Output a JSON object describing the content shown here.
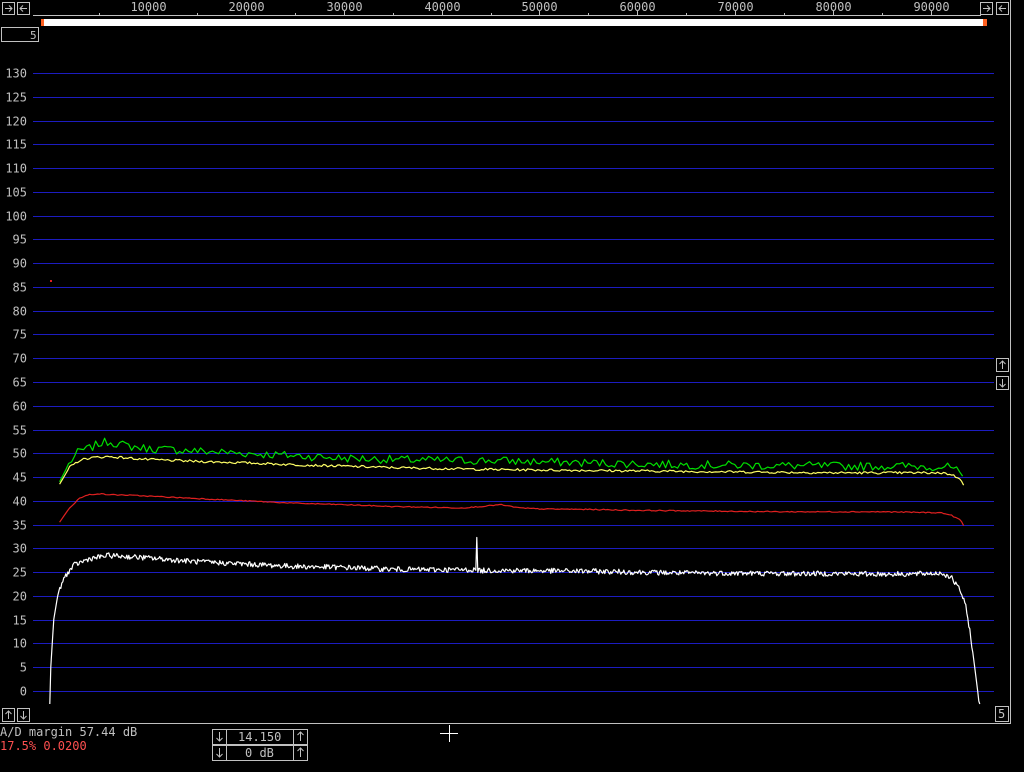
{
  "chart_data": {
    "type": "line",
    "xlabel": "",
    "ylabel": "",
    "xlim": [
      -1000,
      96000
    ],
    "ylim": [
      -5,
      136
    ],
    "x_ticks": [
      10000,
      20000,
      30000,
      40000,
      50000,
      60000,
      70000,
      80000,
      90000
    ],
    "x_tick_labels": [
      "10000",
      "20000",
      "30000",
      "40000",
      "50000",
      "60000",
      "70000",
      "80000",
      "90000"
    ],
    "y_ticks": [
      0,
      5,
      10,
      15,
      20,
      25,
      30,
      35,
      40,
      45,
      50,
      55,
      60,
      65,
      70,
      75,
      80,
      85,
      90,
      95,
      100,
      105,
      110,
      115,
      120,
      125,
      130
    ],
    "y_tick_labels": [
      "0",
      "5",
      "10",
      "15",
      "20",
      "25",
      "30",
      "35",
      "40",
      "45",
      "50",
      "55",
      "60",
      "65",
      "70",
      "75",
      "80",
      "85",
      "90",
      "95",
      "100",
      "105",
      "110",
      "115",
      "120",
      "125",
      "130"
    ],
    "grid": true,
    "series": [
      {
        "color": "#00e000",
        "x": [
          1000,
          2000,
          3000,
          4000,
          5000,
          6000,
          8000,
          10000,
          15000,
          20000,
          25000,
          30000,
          35000,
          40000,
          45000,
          50000,
          55000,
          60000,
          65000,
          70000,
          75000,
          80000,
          85000,
          88000,
          91000,
          92000,
          93000,
          93500
        ],
        "y": [
          44,
          48,
          50.5,
          51,
          52,
          52.5,
          51.5,
          51,
          50.5,
          50,
          49.5,
          49,
          48.7,
          48.5,
          48.5,
          48.2,
          48,
          47.8,
          47.6,
          47.5,
          47.4,
          47.3,
          47.3,
          47.3,
          47.2,
          47,
          46,
          44
        ]
      },
      {
        "color": "#ffff66",
        "x": [
          1000,
          2000,
          3000,
          4000,
          5000,
          6000,
          8000,
          10000,
          15000,
          20000,
          25000,
          30000,
          35000,
          40000,
          45000,
          50000,
          55000,
          60000,
          65000,
          70000,
          75000,
          80000,
          85000,
          88000,
          91000,
          92000,
          93000,
          93500
        ],
        "y": [
          43.5,
          47,
          48.5,
          49,
          49.2,
          49.3,
          49,
          48.7,
          48.3,
          48,
          47.6,
          47.3,
          47,
          46.8,
          46.6,
          46.5,
          46.4,
          46.3,
          46.2,
          46.1,
          46,
          45.9,
          45.9,
          45.9,
          45.9,
          45.6,
          44.5,
          42.5
        ]
      },
      {
        "color": "#e02020",
        "x": [
          1000,
          2000,
          3000,
          4000,
          5000,
          6000,
          8000,
          10000,
          15000,
          20000,
          25000,
          30000,
          35000,
          40000,
          42000,
          44000,
          46000,
          48000,
          50000,
          55000,
          60000,
          65000,
          70000,
          75000,
          80000,
          85000,
          88000,
          91000,
          92000,
          93000,
          93500
        ],
        "y": [
          35.5,
          38.5,
          40.5,
          41.3,
          41.5,
          41.3,
          41.2,
          41,
          40.5,
          40,
          39.5,
          39.2,
          38.8,
          38.6,
          38.5,
          38.8,
          39.2,
          38.5,
          38.3,
          38.2,
          38,
          37.9,
          37.8,
          37.7,
          37.7,
          37.7,
          37.6,
          37.5,
          37,
          36,
          34
        ]
      },
      {
        "color": "#ffffff",
        "x": [
          0,
          100,
          400,
          800,
          1500,
          2500,
          4000,
          6000,
          10000,
          15000,
          20000,
          25000,
          30000,
          35000,
          40000,
          43000,
          43500,
          43600,
          43700,
          43800,
          44000,
          45000,
          50000,
          55000,
          60000,
          65000,
          70000,
          75000,
          80000,
          85000,
          88000,
          91000,
          92000,
          93000,
          93500,
          94000,
          94500,
          94800,
          95000
        ],
        "y": [
          -5,
          5,
          15,
          20,
          24,
          26.5,
          27.8,
          28.5,
          28,
          27.2,
          26.7,
          26.2,
          26,
          25.6,
          25.5,
          25.5,
          25.5,
          32,
          25.5,
          25.3,
          25.3,
          25.4,
          25.3,
          25.2,
          25,
          24.8,
          24.8,
          24.7,
          24.7,
          24.6,
          24.6,
          24.8,
          24,
          21,
          18,
          12,
          4,
          -1,
          -5
        ]
      }
    ]
  },
  "status": {
    "ad_margin": "A/D margin 57.44 dB",
    "percent": "17.5% 0.0200"
  },
  "controls": {
    "gain_value": "14.150",
    "db_value": "0 dB",
    "corner_value": "5"
  },
  "colors": {
    "background": "#000000",
    "grid": "#1c1cc0",
    "axis_text": "#c0c0c0",
    "red_text": "#ff5050"
  }
}
